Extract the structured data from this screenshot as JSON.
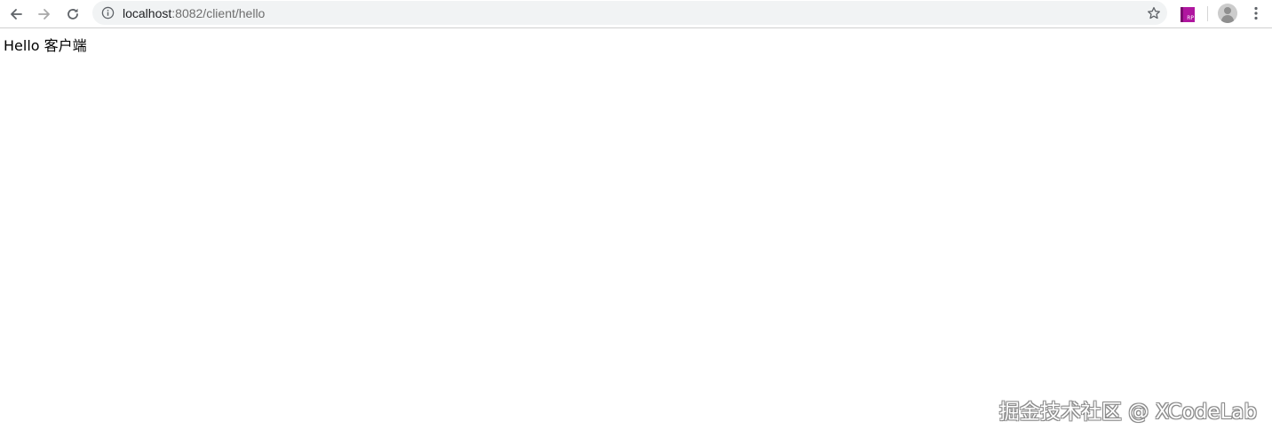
{
  "browser": {
    "icons": {
      "back": "arrow-left-icon",
      "forward": "arrow-right-icon",
      "reload": "reload-icon",
      "info": "info-icon",
      "bookmark": "star-icon",
      "extension": "axure-rp-extension-icon",
      "profile": "avatar-icon",
      "menu": "kebab-menu-icon"
    },
    "address_bar": {
      "host": "localhost",
      "path": ":8082/client/hello"
    },
    "extension_label": "RP",
    "colors": {
      "extension": "#b0169f",
      "omnibox_bg": "#f1f3f4"
    }
  },
  "page": {
    "body_text": "Hello 客户端"
  },
  "watermark": {
    "text": "掘金技术社区 @ XCodeLab"
  }
}
